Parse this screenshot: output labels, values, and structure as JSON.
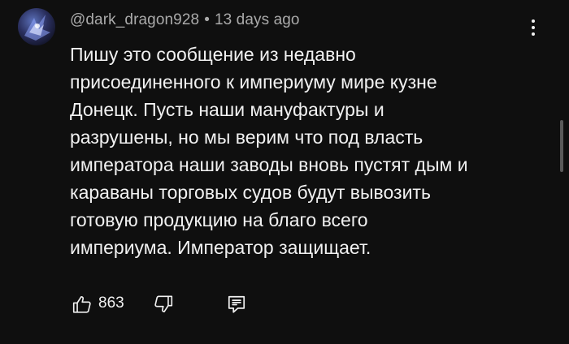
{
  "comment": {
    "author": "@dark_dragon928",
    "separator": "•",
    "time": "13 days ago",
    "text": "Пишу это сообщение из недавно\nприсоединенного к империуму мире кузне\nДонецк. Пусть наши мануфактуры и\nразрушены, но мы верим что под власть\nимператора наши заводы вновь пустят дым и\nкараваны торговых судов будут вывозить\nготовую продукцию на благо всего\nимпериума. Император защищает.",
    "likes": "863"
  },
  "icons": {
    "menu": "kebab-vertical-icon",
    "like": "thumbs-up-icon",
    "dislike": "thumbs-down-icon",
    "reply": "comment-reply-icon"
  },
  "colors": {
    "background": "#0f0f0f",
    "text": "#f1f1f1",
    "meta": "#aaaaaa"
  }
}
